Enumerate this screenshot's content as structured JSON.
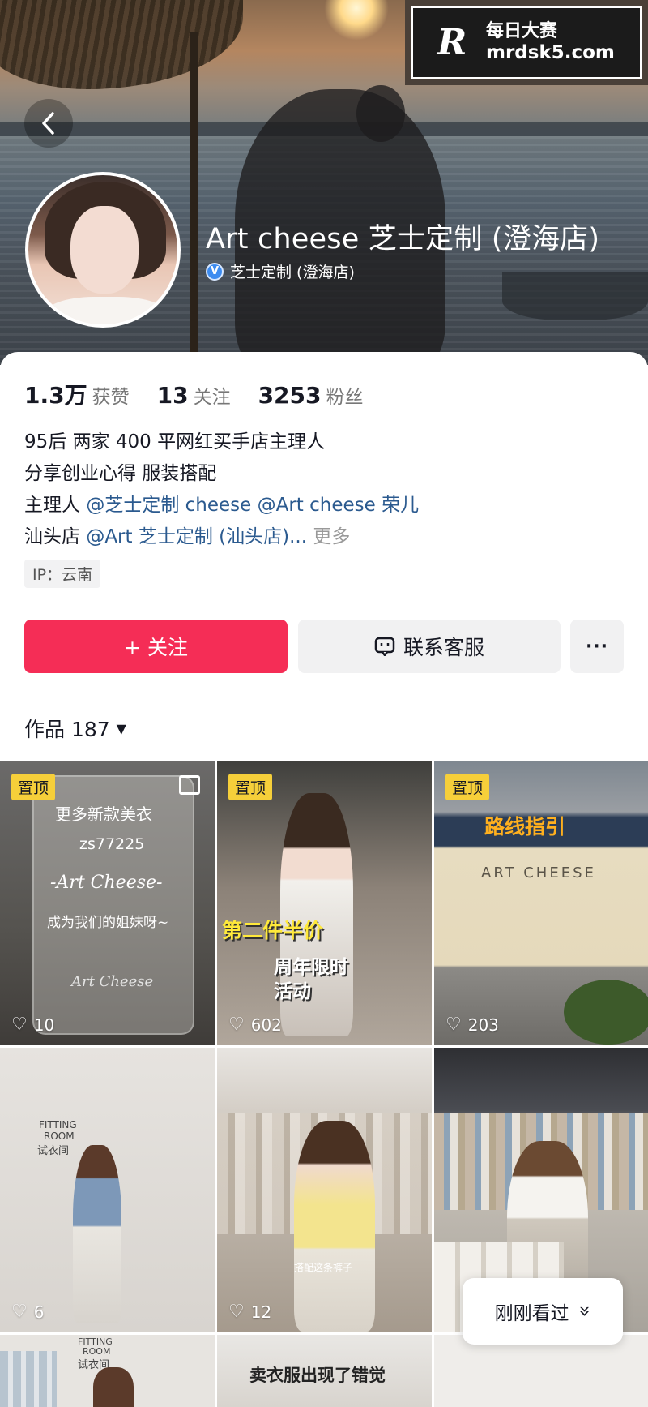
{
  "header": {
    "profile_name": "Art cheese 芝士定制 (澄海店)",
    "verified_label": "芝士定制 (澄海店)",
    "verified_badge": "V"
  },
  "watermark": {
    "logo": "R",
    "line1": "每日大赛",
    "line2": "mrdsk5.com"
  },
  "stats": [
    {
      "value": "1.3万",
      "label": "获赞"
    },
    {
      "value": "13",
      "label": "关注"
    },
    {
      "value": "3253",
      "label": "粉丝"
    }
  ],
  "bio": {
    "line1": "95后 两家 400 平网红买手店主理人",
    "line2": "分享创业心得 服装搭配",
    "line3_prefix": "主理人 ",
    "line3_mention1": "@芝士定制 cheese",
    "line3_space": " ",
    "line3_mention2": "@Art cheese 荣儿",
    "line4_prefix": "汕头店 ",
    "line4_mention": "@Art 芝士定制 (汕头店)...",
    "line4_more": " 更多"
  },
  "ip_label": "IP：云南",
  "actions": {
    "follow": "+ 关注",
    "contact": "联系客服",
    "more": "···"
  },
  "works": {
    "label": "作品 187",
    "caret": "▼"
  },
  "tiles": [
    {
      "pinned": "置顶",
      "likes": "10",
      "overlay": [
        "更多新款美衣",
        "zs77225",
        "-Art Cheese-",
        "成为我们的姐妹呀~",
        "Art Cheese"
      ]
    },
    {
      "pinned": "置顶",
      "likes": "602",
      "overlay": [
        "第二件半价",
        "周年限时",
        "活动"
      ]
    },
    {
      "pinned": "置顶",
      "likes": "203",
      "overlay": [
        "路线指引",
        "ART CHEESE"
      ]
    },
    {
      "likes": "6",
      "overlay": [
        "FITTING",
        "ROOM",
        "试衣间"
      ]
    },
    {
      "likes": "12",
      "overlay": [
        "搭配这条裤子"
      ]
    },
    {
      "likes": "",
      "overlay": []
    },
    {
      "overlay": [
        "FITTING",
        "ROOM",
        "试衣间"
      ]
    },
    {
      "overlay": [
        "卖衣服出现了错觉"
      ]
    },
    {
      "overlay": []
    }
  ],
  "recently_viewed": {
    "label": "刚刚看过",
    "icon": "»"
  },
  "icons": {
    "back": "chevron-left-icon",
    "heart": "♡",
    "contact": "message-icon"
  },
  "colors": {
    "follow": "#f52d56",
    "mention": "#2b5a8f",
    "pin": "#f6cf3a"
  }
}
